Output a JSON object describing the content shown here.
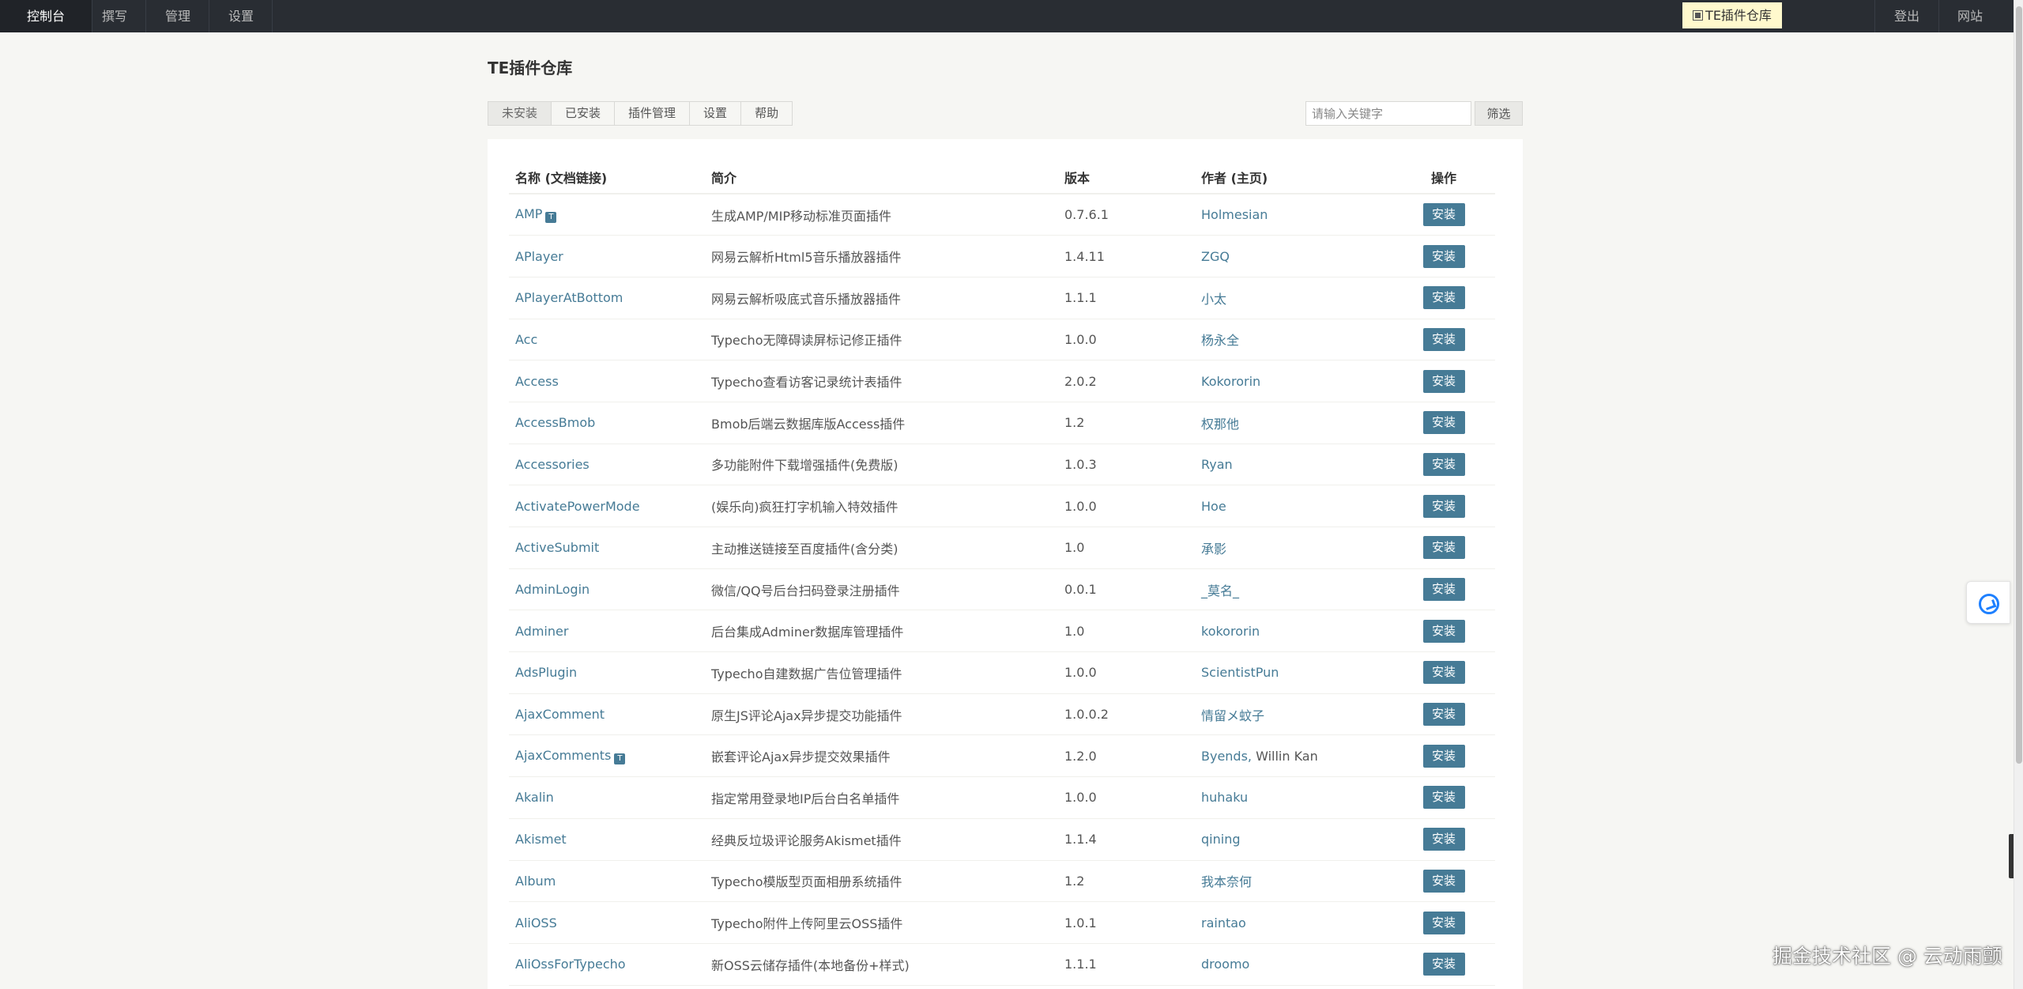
{
  "nav": {
    "items": [
      "控制台",
      "撰写",
      "管理",
      "设置"
    ],
    "plugin_store": "TE插件仓库",
    "logout": "登出",
    "website": "网站"
  },
  "page": {
    "title": "TE插件仓库",
    "tabs": [
      "未安装",
      "已安装",
      "插件管理",
      "设置",
      "帮助"
    ],
    "search_placeholder": "请输入关键字",
    "filter_label": "筛选"
  },
  "table": {
    "headers": [
      "名称 (文档链接)",
      "简介",
      "版本",
      "作者 (主页)",
      "操作"
    ],
    "install_label": "安装",
    "doc_icon": "T",
    "rows": [
      {
        "name": "AMP",
        "doc": true,
        "desc": "生成AMP/MIP移动标准页面插件",
        "version": "0.7.6.1",
        "author": "Holmesian",
        "author2": ""
      },
      {
        "name": "APlayer",
        "doc": false,
        "desc": "网易云解析Html5音乐播放器插件",
        "version": "1.4.11",
        "author": "ZGQ",
        "author2": ""
      },
      {
        "name": "APlayerAtBottom",
        "doc": false,
        "desc": "网易云解析吸底式音乐播放器插件",
        "version": "1.1.1",
        "author": "小太",
        "author2": ""
      },
      {
        "name": "Acc",
        "doc": false,
        "desc": "Typecho无障碍读屏标记修正插件",
        "version": "1.0.0",
        "author": "杨永全",
        "author2": ""
      },
      {
        "name": "Access",
        "doc": false,
        "desc": "Typecho查看访客记录统计表插件",
        "version": "2.0.2",
        "author": "Kokororin",
        "author2": ""
      },
      {
        "name": "AccessBmob",
        "doc": false,
        "desc": "Bmob后端云数据库版Access插件",
        "version": "1.2",
        "author": "权那他",
        "author2": ""
      },
      {
        "name": "Accessories",
        "doc": false,
        "desc": "多功能附件下载增强插件(免费版)",
        "version": "1.0.3",
        "author": "Ryan",
        "author2": ""
      },
      {
        "name": "ActivatePowerMode",
        "doc": false,
        "desc": "(娱乐向)疯狂打字机输入特效插件",
        "version": "1.0.0",
        "author": "Hoe",
        "author2": ""
      },
      {
        "name": "ActiveSubmit",
        "doc": false,
        "desc": "主动推送链接至百度插件(含分类)",
        "version": "1.0",
        "author": "承影",
        "author2": ""
      },
      {
        "name": "AdminLogin",
        "doc": false,
        "desc": "微信/QQ号后台扫码登录注册插件",
        "version": "0.0.1",
        "author": "_莫名_",
        "author2": ""
      },
      {
        "name": "Adminer",
        "doc": false,
        "desc": "后台集成Adminer数据库管理插件",
        "version": "1.0",
        "author": "kokororin",
        "author2": ""
      },
      {
        "name": "AdsPlugin",
        "doc": false,
        "desc": "Typecho自建数据广告位管理插件",
        "version": "1.0.0",
        "author": "ScientistPun",
        "author2": ""
      },
      {
        "name": "AjaxComment",
        "doc": false,
        "desc": "原生JS评论Ajax异步提交功能插件",
        "version": "1.0.0.2",
        "author": "情留メ蚊子",
        "author2": ""
      },
      {
        "name": "AjaxComments",
        "doc": true,
        "desc": "嵌套评论Ajax异步提交效果插件",
        "version": "1.2.0",
        "author": "Byends,",
        "author2": " Willin Kan"
      },
      {
        "name": "Akalin",
        "doc": false,
        "desc": "指定常用登录地IP后台白名单插件",
        "version": "1.0.0",
        "author": "huhaku",
        "author2": ""
      },
      {
        "name": "Akismet",
        "doc": false,
        "desc": "经典反垃圾评论服务Akismet插件",
        "version": "1.1.4",
        "author": "qining",
        "author2": ""
      },
      {
        "name": "Album",
        "doc": false,
        "desc": "Typecho模版型页面相册系统插件",
        "version": "1.2",
        "author": "我本奈何",
        "author2": ""
      },
      {
        "name": "AliOSS",
        "doc": false,
        "desc": "Typecho附件上传阿里云OSS插件",
        "version": "1.0.1",
        "author": "raintao",
        "author2": ""
      },
      {
        "name": "AliOssForTypecho",
        "doc": false,
        "desc": "新OSS云储存插件(本地备份+样式)",
        "version": "1.1.1",
        "author": "droomo",
        "author2": ""
      }
    ]
  },
  "watermark": "掘金技术社区 @ 云动雨颤"
}
